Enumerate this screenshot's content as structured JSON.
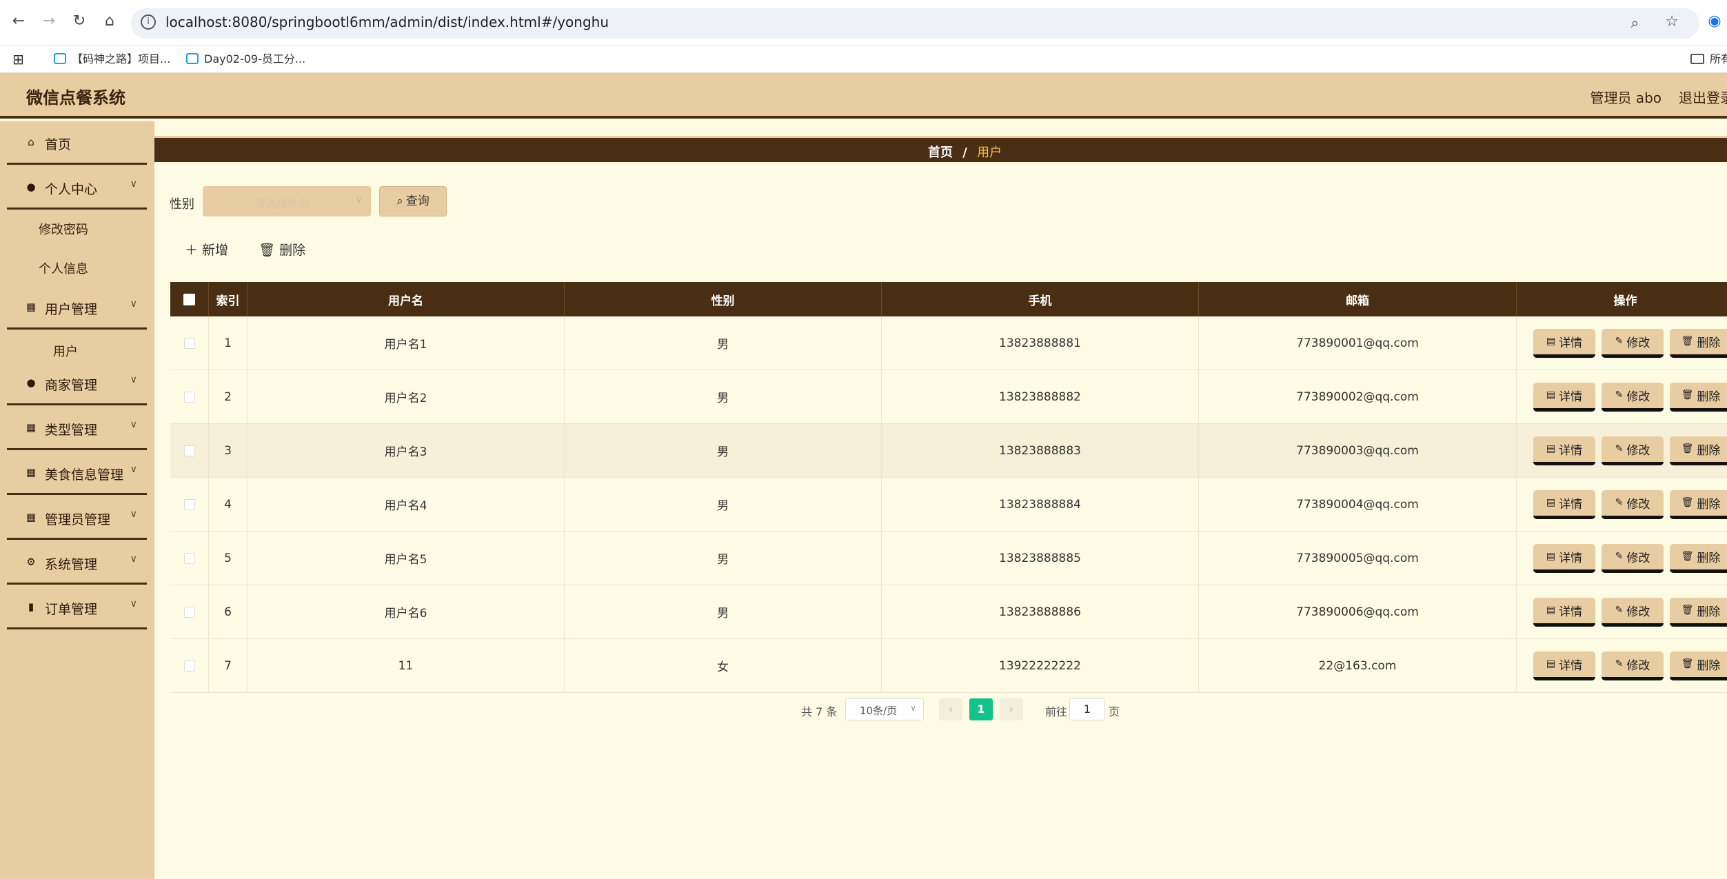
{
  "browser": {
    "url": "localhost:8080/springbootl6mm/admin/dist/index.html#/yonghu",
    "bookmarks": [
      "【码神之路】项目...",
      "Day02-09-员工分...",
      "所有"
    ]
  },
  "header": {
    "title": "微信点餐系统",
    "user": "管理员 abo",
    "logout": "退出登录"
  },
  "sidebar": {
    "home": "首页",
    "personal": "个人中心",
    "change_password": "修改密码",
    "profile": "个人信息",
    "user_mgmt": "用户管理",
    "user": "用户",
    "merchant_mgmt": "商家管理",
    "type_mgmt": "类型管理",
    "food_mgmt": "美食信息管理",
    "admin_mgmt": "管理员管理",
    "system_mgmt": "系统管理",
    "order_mgmt": "订单管理"
  },
  "breadcrumb": {
    "home": "首页",
    "sep": "/",
    "current": "用户"
  },
  "search": {
    "label": "性别",
    "placeholder": "请选择性别",
    "query": "查询"
  },
  "toolbar": {
    "add": "新增",
    "delete": "删除"
  },
  "table": {
    "headers": [
      "索引",
      "用户名",
      "性别",
      "手机",
      "邮箱",
      "操作"
    ],
    "actions": {
      "detail": "详情",
      "edit": "修改",
      "delete": "删除"
    },
    "rows": [
      {
        "index": "1",
        "username": "用户名1",
        "sex": "男",
        "phone": "13823888881",
        "email": "773890001@qq.com"
      },
      {
        "index": "2",
        "username": "用户名2",
        "sex": "男",
        "phone": "13823888882",
        "email": "773890002@qq.com"
      },
      {
        "index": "3",
        "username": "用户名3",
        "sex": "男",
        "phone": "13823888883",
        "email": "773890003@qq.com"
      },
      {
        "index": "4",
        "username": "用户名4",
        "sex": "男",
        "phone": "13823888884",
        "email": "773890004@qq.com"
      },
      {
        "index": "5",
        "username": "用户名5",
        "sex": "男",
        "phone": "13823888885",
        "email": "773890005@qq.com"
      },
      {
        "index": "6",
        "username": "用户名6",
        "sex": "男",
        "phone": "13823888886",
        "email": "773890006@qq.com"
      },
      {
        "index": "7",
        "username": "11",
        "sex": "女",
        "phone": "13922222222",
        "email": "22@163.com"
      }
    ]
  },
  "pagination": {
    "total": "共 7 条",
    "page_size": "10条/页",
    "current": "1",
    "goto_prefix": "前往",
    "goto_value": "1",
    "goto_suffix": "页"
  },
  "colors": {
    "header_bg": "#e9cda2",
    "dark_brown": "#4a2e13",
    "content_bg": "#fdfbe4",
    "active_page": "#13c28a"
  }
}
